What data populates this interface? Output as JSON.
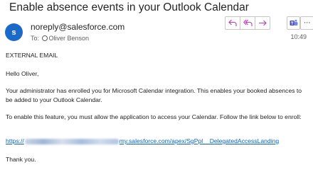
{
  "email": {
    "subject": "Enable absence events in your Outlook Calendar",
    "avatar_initial": "s",
    "sender": "noreply@salesforce.com",
    "to_label": "To:",
    "recipient": "Oliver Benson",
    "time": "10:49",
    "actions": {
      "reply_icon": "reply-icon",
      "reply_all_icon": "reply-all-icon",
      "forward_icon": "forward-icon",
      "teams_icon": "teams-icon",
      "more_label": "···"
    }
  },
  "body": {
    "external_banner": "EXTERNAL EMAIL",
    "greeting": "Hello Oliver,",
    "paragraph1": "Your administrator has enrolled you for Microsoft Calendar integration. This enables your booked absences to be added to your Outlook Calendar.",
    "paragraph2": "To enable this feature, you must allow the application to access your Calendar. Follow the link below to enroll:",
    "link_prefix": "https://",
    "link_suffix": "my.salesforce.com/apex/SgPpl__DelegatedAccessLanding",
    "closing": "Thank you."
  },
  "colors": {
    "accent": "#1b6ac9",
    "link": "#0563c1",
    "action_icon": "#c239b3"
  }
}
